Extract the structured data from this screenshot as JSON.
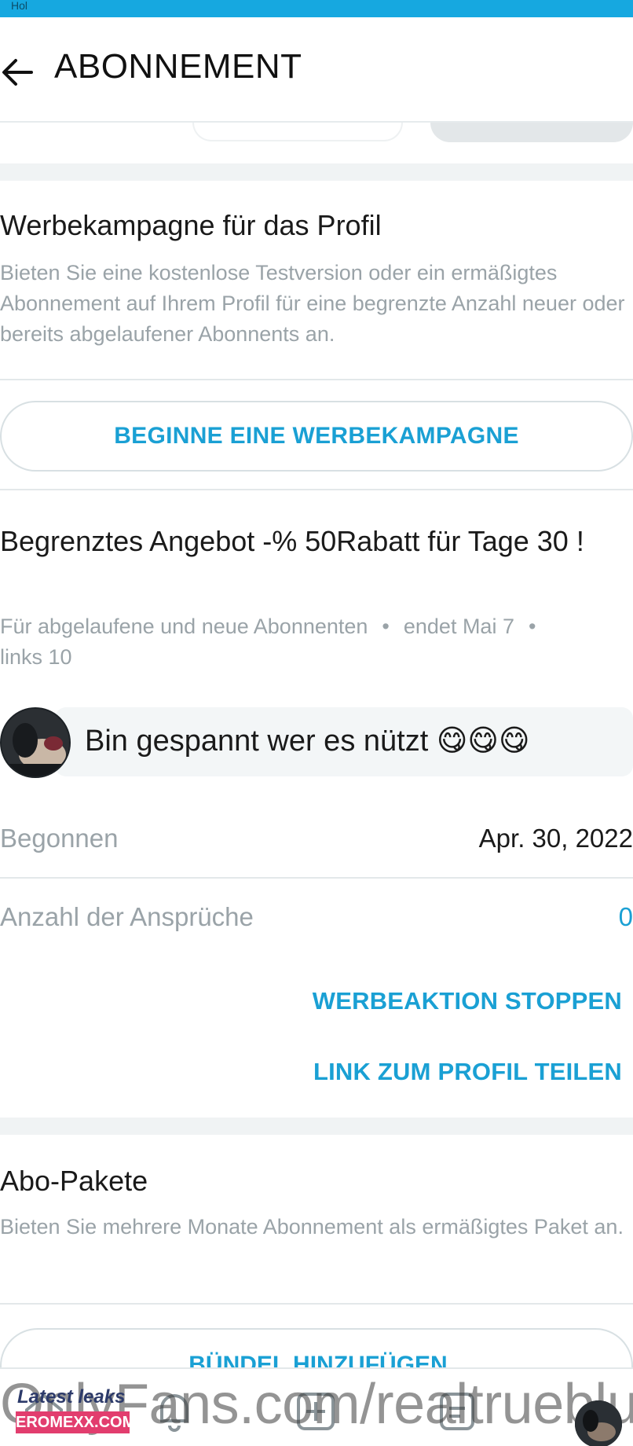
{
  "status_bar": {
    "carrier": "Hol"
  },
  "header": {
    "title": "ABONNEMENT"
  },
  "campaign": {
    "title": "Werbekampagne für das Profil",
    "description": "Bieten Sie eine kostenlose Testversion oder ein ermäßigtes Abonnement auf Ihrem Profil für eine begrenzte Anzahl neuer oder bereits abgelaufener Abonnents an.",
    "button_label": "BEGINNE EINE WERBEKAMPAGNE"
  },
  "offer": {
    "title": "Begrenztes Angebot -% 50Rabatt für Tage 30 !",
    "audience": "Für abgelaufene und neue Abonnenten",
    "separator": "•",
    "ends": "endet Mai 7",
    "links_left": "links 10",
    "message": "Bin gespannt wer es nützt 😋😋😋",
    "started_label": "Begonnen",
    "started_value": "Apr. 30, 2022",
    "claims_label": "Anzahl der Ansprüche",
    "claims_value": "0",
    "stop_label": "WERBEAKTION STOPPEN",
    "share_label": "LINK ZUM PROFIL TEILEN"
  },
  "bundles": {
    "title": "Abo-Pakete",
    "description": "Bieten Sie mehrere Monate Abonnement als ermäßigtes Paket an.",
    "button_label": "BÜNDEL HINZUFÜGEN"
  },
  "watermark": {
    "url_text": "OnlyFans.com/realtrueblu",
    "badge_line1": "Latest leaks",
    "badge_line2": "EROMEXX.COM"
  },
  "colors": {
    "accent": "#1aa0d4",
    "status_bar": "#16a8e0",
    "muted_text": "#9aa3a8"
  }
}
